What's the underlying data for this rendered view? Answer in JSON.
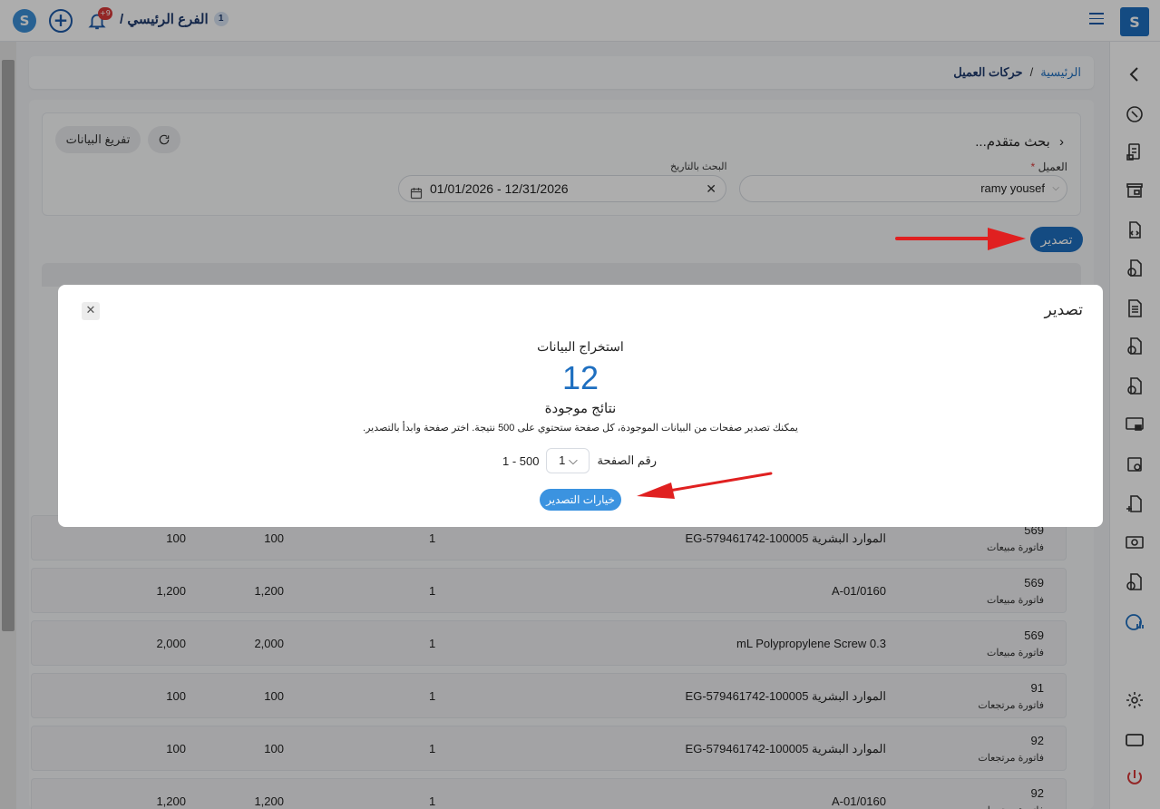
{
  "topbar": {
    "branch_label": "الفرع الرئيسي /",
    "branch_count": "1",
    "notif_badge": "+9"
  },
  "breadcrumb": {
    "home": "الرئيسية",
    "sep": "/",
    "current": "حركات العميل"
  },
  "search": {
    "title": "بحث متقدم...",
    "clear_label": "تفريغ البيانات",
    "client_label": "العميل",
    "client_required": "*",
    "client_value": "ramy yousef",
    "date_label": "البحث بالتاريخ",
    "date_value": "01/01/2026 - 12/31/2026"
  },
  "export_button": "تصدير",
  "rows": [
    {
      "num": "569",
      "type": "فاتورة مبيعات",
      "item": "EG-579461742-100005 الموارد البشرية",
      "qty": "1",
      "price": "100",
      "total": "100"
    },
    {
      "num": "569",
      "type": "فاتورة مبيعات",
      "item": "A-01/0160",
      "qty": "1",
      "price": "1,200",
      "total": "1,200"
    },
    {
      "num": "569",
      "type": "فاتورة مبيعات",
      "item": "mL Polypropylene Screw 0.3",
      "qty": "1",
      "price": "2,000",
      "total": "2,000"
    },
    {
      "num": "91",
      "type": "فاتورة مرتجعات",
      "item": "EG-579461742-100005 الموارد البشرية",
      "qty": "1",
      "price": "100",
      "total": "100"
    },
    {
      "num": "92",
      "type": "فاتورة مرتجعات",
      "item": "EG-579461742-100005 الموارد البشرية",
      "qty": "1",
      "price": "100",
      "total": "100"
    },
    {
      "num": "92",
      "type": "فاتورة مرتجعات",
      "item": "A-01/0160",
      "qty": "1",
      "price": "1,200",
      "total": "1,200"
    }
  ],
  "modal": {
    "title": "تصدير",
    "close": "✕",
    "heading": "استخراج البيانات",
    "count": "12",
    "found": "نتائج موجودة",
    "description": "يمكنك تصدير صفحات من البيانات الموجودة، كل صفحة ستحتوي على 500 نتيجة. اختر صفحة وابدأ بالتصدير.",
    "page_label": "رقم الصفحة",
    "page_value": "1",
    "page_range": "1 - 500",
    "export_options": "خيارات التصدير"
  },
  "colors": {
    "primary": "#1e6fc0",
    "accent": "#3b93e0",
    "arrow": "#e02020"
  },
  "icons": {
    "sidebar": [
      "chevron-left-icon",
      "compass-icon",
      "receipt-icon",
      "store-icon",
      "document-transfer-icon",
      "document-edit-icon",
      "document-lines-icon",
      "document-gear-icon",
      "document-check-icon",
      "monitor-icon",
      "document-add-icon",
      "document-plus-icon",
      "cash-icon",
      "document-money-icon",
      "chart-icon",
      "settings-icon",
      "window-icon",
      "power-icon"
    ]
  }
}
